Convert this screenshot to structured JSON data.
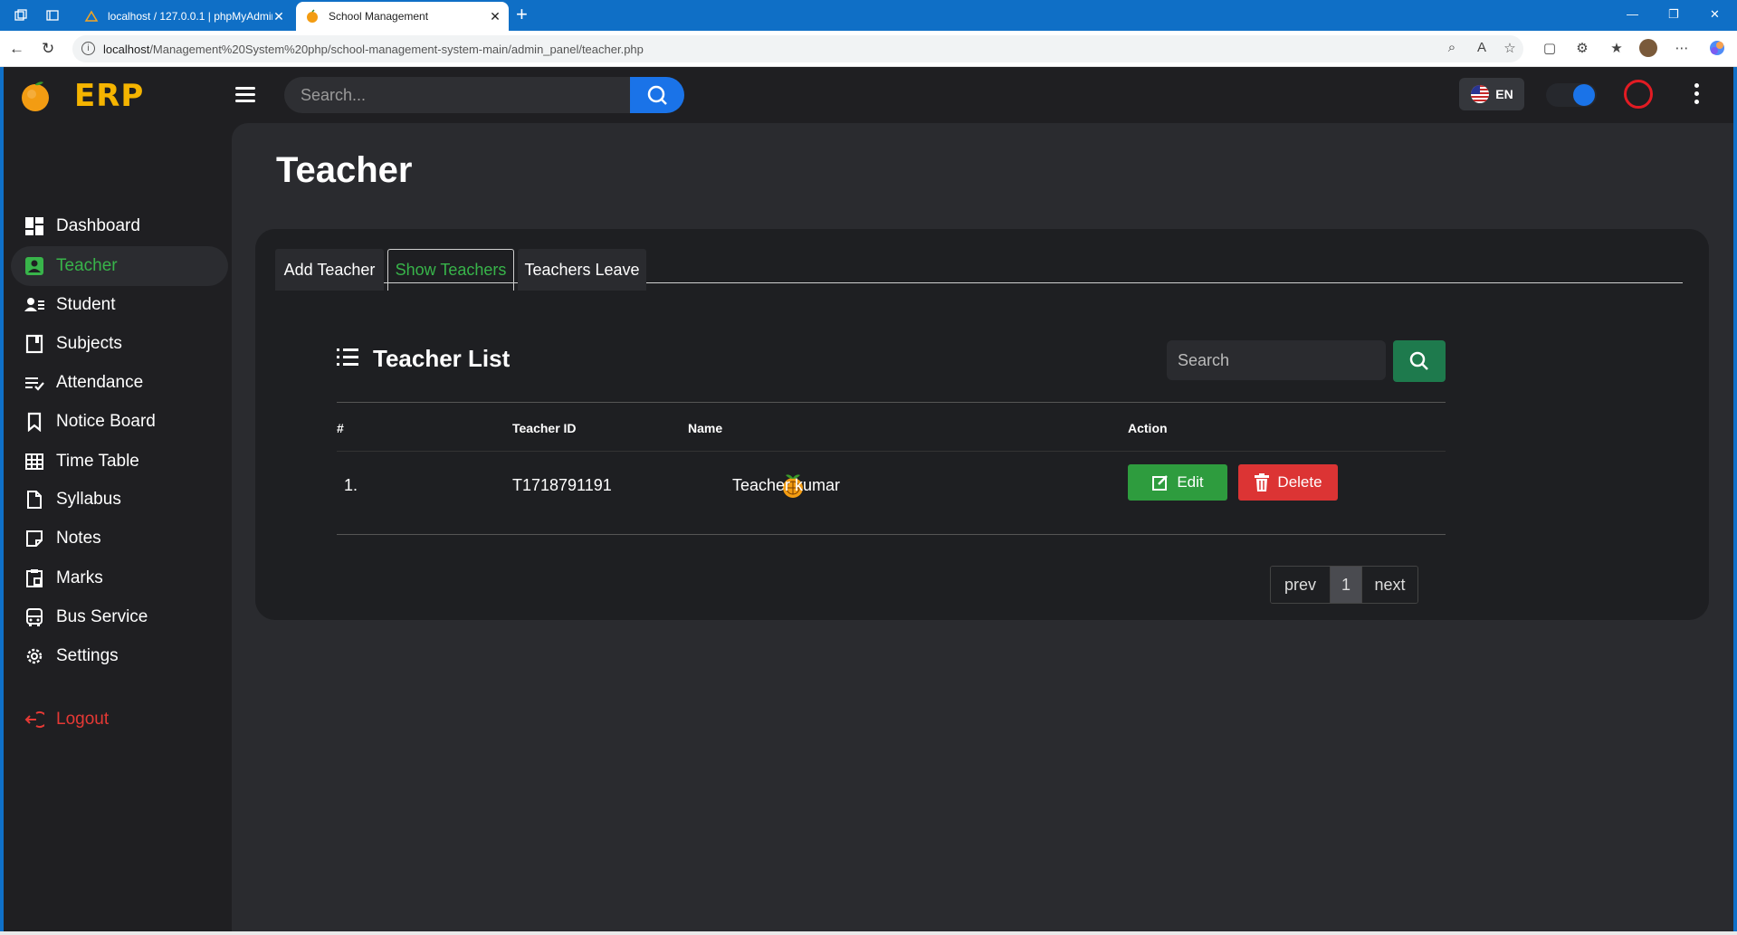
{
  "browser": {
    "tabs": [
      {
        "title": "localhost / 127.0.0.1 | phpMyAdmin"
      },
      {
        "title": "School Management"
      }
    ],
    "url_host": "localhost",
    "url_path": "/Management%20System%20php/school-management-system-main/admin_panel/teacher.php"
  },
  "app": {
    "logo": "ERP",
    "search_placeholder": "Search...",
    "lang": "EN"
  },
  "sidebar": {
    "items": [
      {
        "label": "Dashboard",
        "icon": "dashboard-icon"
      },
      {
        "label": "Teacher",
        "icon": "teacher-icon",
        "active": true
      },
      {
        "label": "Student",
        "icon": "student-icon"
      },
      {
        "label": "Subjects",
        "icon": "book-icon"
      },
      {
        "label": "Attendance",
        "icon": "attendance-icon"
      },
      {
        "label": "Notice Board",
        "icon": "bookmark-icon"
      },
      {
        "label": "Time Table",
        "icon": "table-icon"
      },
      {
        "label": "Syllabus",
        "icon": "file-icon"
      },
      {
        "label": "Notes",
        "icon": "note-icon"
      },
      {
        "label": "Marks",
        "icon": "marks-icon"
      },
      {
        "label": "Bus Service",
        "icon": "bus-icon"
      },
      {
        "label": "Settings",
        "icon": "gear-icon"
      }
    ],
    "logout": "Logout"
  },
  "page": {
    "title": "Teacher",
    "tabs": [
      "Add Teacher",
      "Show Teachers",
      "Teachers Leave"
    ],
    "list_title": "Teacher List",
    "search_placeholder": "Search",
    "columns": [
      "#",
      "Teacher ID",
      "Name",
      "Action"
    ],
    "rows": [
      {
        "index": "1.",
        "teacher_id": "T1718791191",
        "name": "Teacher kumar"
      }
    ],
    "edit_label": "Edit",
    "delete_label": "Delete",
    "pager": {
      "prev": "prev",
      "page": "1",
      "next": "next"
    }
  },
  "colors": {
    "accent": "#38b44a",
    "brand": "#f5b400",
    "primary": "#1a73e8",
    "danger": "#dc3434"
  }
}
